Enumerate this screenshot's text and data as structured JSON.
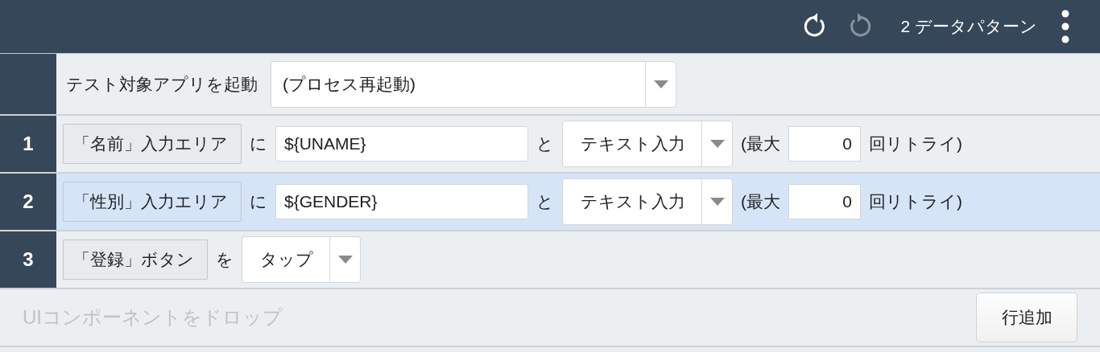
{
  "toolbar": {
    "undo": {
      "disabled": false
    },
    "redo": {
      "disabled": true
    },
    "pattern_count": "2 データパターン"
  },
  "steps": [
    {
      "kind": "launch",
      "selected": false,
      "label": "テスト対象アプリを起動",
      "select": "(プロセス再起動)"
    },
    {
      "kind": "input",
      "selected": false,
      "number": "1",
      "element": "「名前」入力エリア",
      "particle": "に",
      "value": "${UNAME}",
      "particle2": "と",
      "select": "テキスト入力",
      "retry_prefix": "(最大",
      "retry_count": "0",
      "retry_suffix": "回リトライ)"
    },
    {
      "kind": "input",
      "selected": true,
      "number": "2",
      "element": "「性別」入力エリア",
      "particle": "に",
      "value": "${GENDER}",
      "particle2": "と",
      "select": "テキスト入力",
      "retry_prefix": "(最大",
      "retry_count": "0",
      "retry_suffix": "回リトライ)"
    },
    {
      "kind": "tap",
      "selected": false,
      "number": "3",
      "element": "「登録」ボタン",
      "particle": "を",
      "select": "タップ"
    }
  ],
  "drop_zone": {
    "placeholder": "UIコンポーネントをドロップ",
    "add_row_button": "行追加"
  }
}
